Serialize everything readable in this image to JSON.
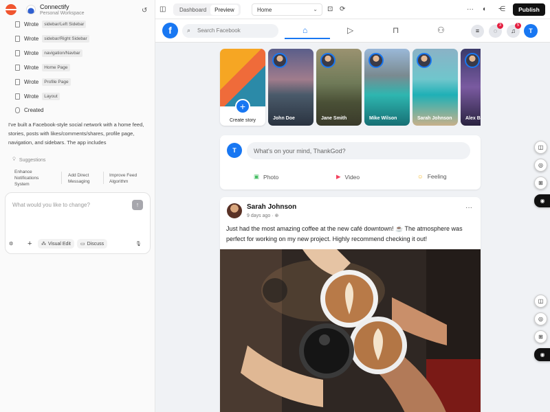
{
  "project": {
    "name": "Connectify",
    "workspace": "Personal Workspace"
  },
  "activity": [
    {
      "verb": "Wrote",
      "target": "sidebar/Left Sidebar"
    },
    {
      "verb": "Wrote",
      "target": "sidebar/Right Sidebar"
    },
    {
      "verb": "Wrote",
      "target": "navigation/Navbar"
    },
    {
      "verb": "Wrote",
      "target": "Home Page"
    },
    {
      "verb": "Wrote",
      "target": "Profile Page"
    },
    {
      "verb": "Wrote",
      "target": "Layout"
    },
    {
      "verb": "Created",
      "target": ""
    }
  ],
  "summary": "I've built a Facebook-style social network with a home feed, stories, posts with likes/comments/shares, profile page, navigation, and sidebars. The app includes",
  "suggestions": {
    "label": "Suggestions",
    "items": [
      "Enhance Notifications System",
      "Add Direct Messaging",
      "Improve Feed Algorithm"
    ]
  },
  "composer": {
    "placeholder": "What would you like to change?",
    "visual_edit": "Visual Edit",
    "discuss": "Discuss"
  },
  "topbar": {
    "tabs": [
      "Dashboard",
      "Preview"
    ],
    "active_tab": "Preview",
    "route": "Home",
    "publish": "Publish"
  },
  "fb": {
    "logo": "f",
    "search_placeholder": "Search Facebook",
    "messages_badge": "3",
    "notifications_badge": "5",
    "user_initial": "T",
    "stories": [
      {
        "name": "Create story",
        "create": true
      },
      {
        "name": "John Doe"
      },
      {
        "name": "Jane Smith"
      },
      {
        "name": "Mike Wilson"
      },
      {
        "name": "Sarah Johnson"
      },
      {
        "name": "Alex B"
      }
    ],
    "whats_on_mind": "What's on your mind, ThankGod?",
    "actions": [
      "Photo",
      "Video",
      "Feeling"
    ],
    "post": {
      "author": "Sarah Johnson",
      "time": "9 days ago ·",
      "text": "Just had the most amazing coffee at the new café downtown! ☕ The atmosphere was perfect for working on my new project. Highly recommend checking it out!"
    }
  },
  "colors": {
    "accent": "#1877f2",
    "badge": "#e41e3f",
    "publish_bg": "#111111"
  }
}
